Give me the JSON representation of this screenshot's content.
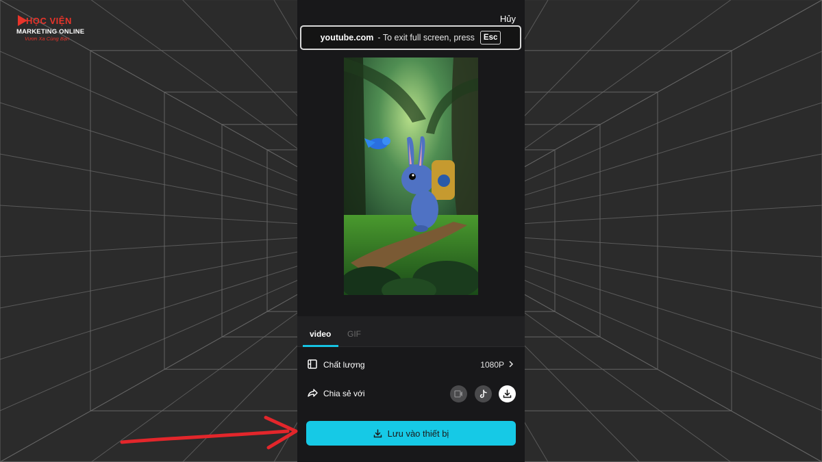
{
  "logo": {
    "line1": "HỌC VIỆN",
    "line2": "MARKETING ONLINE",
    "line3": "Vươn Xa Cùng Bạn"
  },
  "panel": {
    "cancel_label": "Hủy"
  },
  "fullscreen_banner": {
    "domain": "youtube.com",
    "message": "-  To exit full screen, press",
    "key": "Esc"
  },
  "tabs": [
    {
      "label": "video",
      "active": true
    },
    {
      "label": "GIF",
      "active": false
    }
  ],
  "settings": {
    "quality": {
      "label": "Chất lượng",
      "value": "1080P",
      "icon": "film-icon"
    },
    "share": {
      "label": "Chia sẻ với",
      "icon": "share-arrow-icon",
      "targets": [
        "video-reel-icon",
        "tiktok-icon",
        "download-icon"
      ]
    }
  },
  "save_button": {
    "label": "Lưu vào thiết bị",
    "icon": "download-icon"
  },
  "colors": {
    "accent": "#16c9e6",
    "panel_bg": "#18181a",
    "arrow": "#e3262b",
    "brand_red": "#e8342a"
  }
}
